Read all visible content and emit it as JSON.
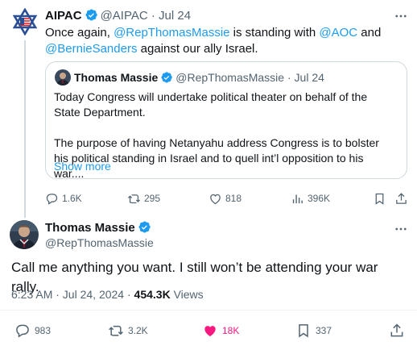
{
  "tweet1": {
    "author_name": "AIPAC",
    "author_handle": "@AIPAC",
    "separator": "·",
    "date": "Jul 24",
    "text_parts": {
      "p1": "Once again, ",
      "mention1": "@RepThomasMassie",
      "p2": " is standing with ",
      "mention2": "@AOC",
      "p3": " and",
      "mention3": "@BernieSanders",
      "p4": " against our ally Israel."
    },
    "quote": {
      "author_name": "Thomas Massie",
      "author_handle": "@RepThomasMassie",
      "separator": "·",
      "date": "Jul 24",
      "para1": "Today Congress will undertake political theater on behalf of the State Department.",
      "para2": "The purpose of having Netanyahu address Congress is to bolster his political standing in Israel and to quell int’l opposition to his war....",
      "show_more": "Show more"
    },
    "stats": {
      "replies": "1.6K",
      "reposts": "295",
      "likes": "818",
      "views": "396K"
    }
  },
  "tweet2": {
    "author_name": "Thomas Massie",
    "author_handle": "@RepThomasMassie",
    "text": "Call me anything you want. I still won’t be attending your war rally.",
    "time": "6:23 AM · Jul 24, 2024 · ",
    "views_count": "454.3K",
    "views_label": " Views",
    "stats": {
      "replies": "983",
      "reposts": "3.2K",
      "likes": "18K",
      "bookmarks": "337"
    }
  },
  "colors": {
    "accent": "#1d9bf0",
    "muted": "#536471",
    "like_active": "#f91880",
    "border": "#cfd9de"
  },
  "icons": [
    "star-of-david-logo-icon",
    "verified-badge-icon",
    "more-icon",
    "reply-icon",
    "repost-icon",
    "like-icon",
    "views-icon",
    "bookmark-icon",
    "share-icon"
  ]
}
